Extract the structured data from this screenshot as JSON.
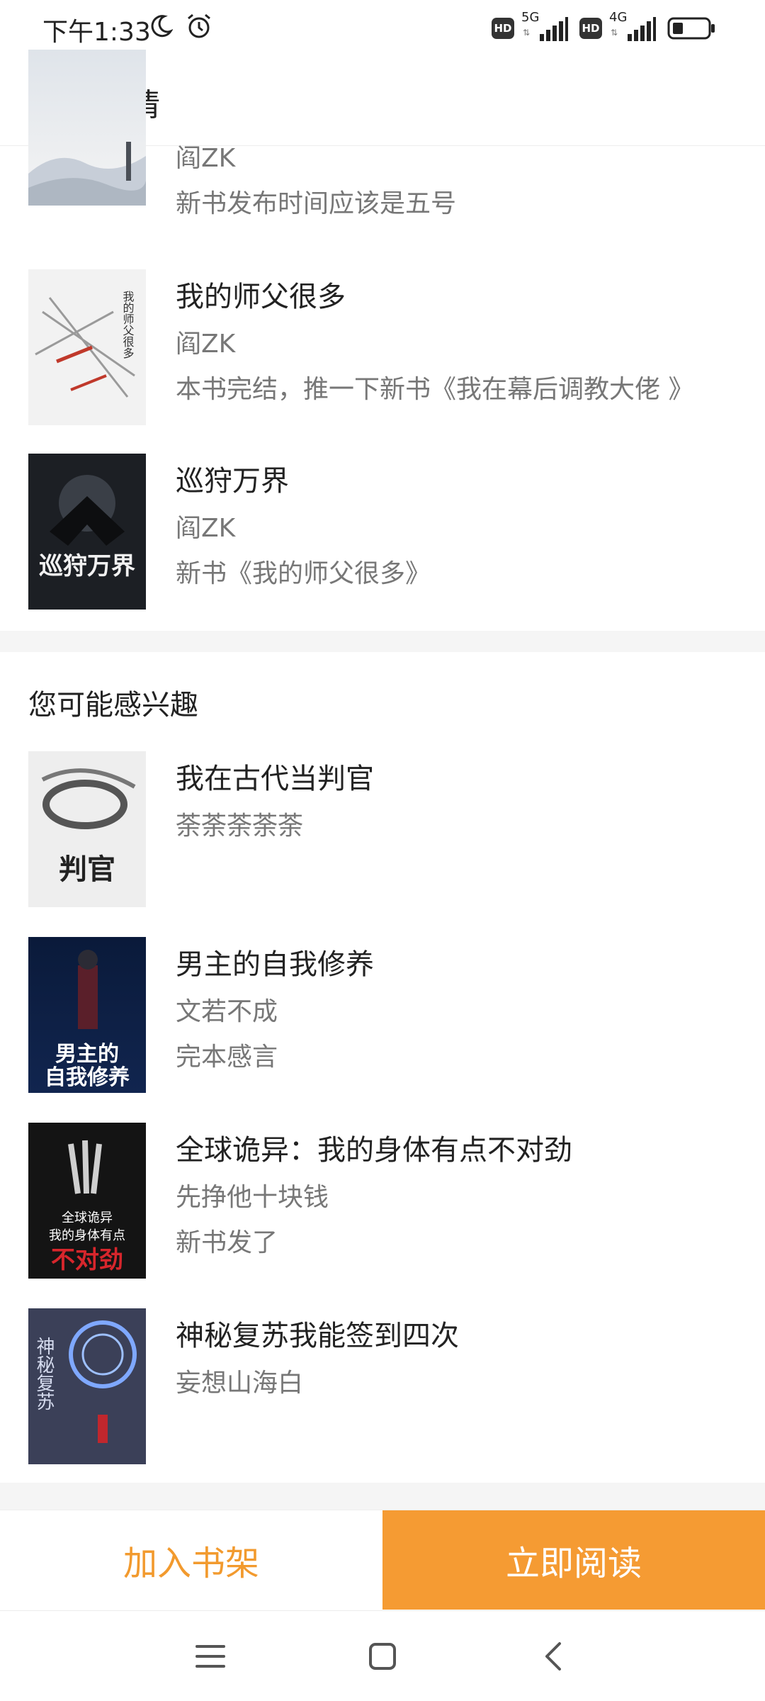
{
  "status_bar": {
    "time": "下午1:33",
    "hd1": "HD",
    "net1": "5G",
    "hd2": "HD",
    "net2": "4G"
  },
  "header": {
    "title": "详情"
  },
  "author_books": [
    {
      "title": "",
      "author": "阎ZK",
      "note": "新书发布时间应该是五号"
    },
    {
      "title": "我的师父很多",
      "author": "阎ZK",
      "note": "本书完结，推一下新书《我在幕后调教大佬 》"
    },
    {
      "title": "巡狩万界",
      "author": "阎ZK",
      "note": "新书《我的师父很多》"
    }
  ],
  "recommend": {
    "heading": "您可能感兴趣",
    "books": [
      {
        "title": "我在古代当判官",
        "author": "荼荼荼荼荼",
        "note": ""
      },
      {
        "title": "男主的自我修养",
        "author": "文若不成",
        "note": "完本感言"
      },
      {
        "title": "全球诡异：我的身体有点不对劲",
        "author": "先挣他十块钱",
        "note": "新书发了"
      },
      {
        "title": "神秘复苏我能签到四次",
        "author": "妄想山海白",
        "note": ""
      }
    ]
  },
  "actions": {
    "add_shelf": "加入书架",
    "read_now": "立即阅读"
  },
  "colors": {
    "accent": "#f59b33",
    "accent_text": "#f29a2e",
    "secondary_text": "#777777"
  },
  "icons": {
    "back": "back-arrow-icon",
    "moon": "moon-icon",
    "alarm": "alarm-icon",
    "battery": "battery-icon",
    "signal": "signal-icon",
    "nav_menu": "menu-icon",
    "nav_home": "home-icon",
    "nav_back": "chevron-left-icon"
  }
}
